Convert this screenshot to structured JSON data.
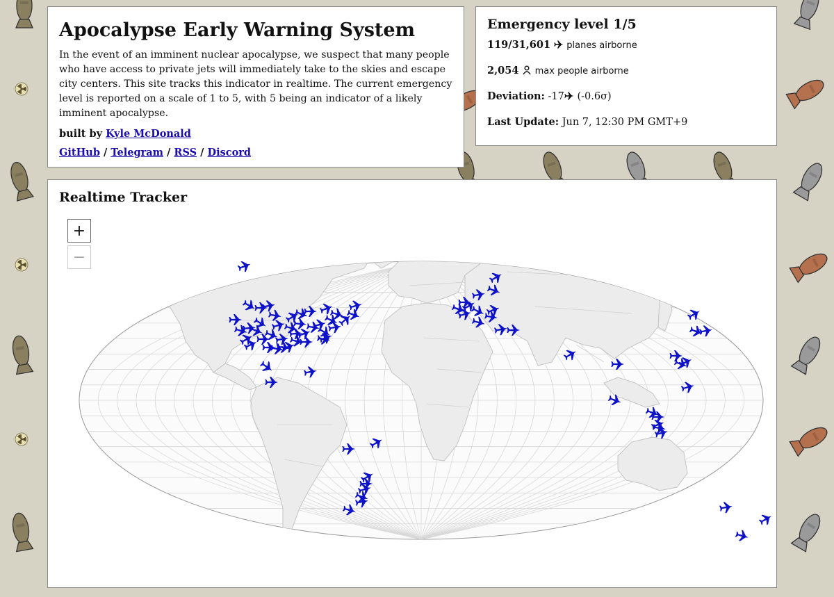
{
  "intro": {
    "title": "Apocalypse Early Warning System",
    "description": "In the event of an imminent nuclear apocalypse, we suspect that many people who have access to private jets will immediately take to the skies and escape city centers. This site tracks this indicator in realtime. The current emergency level is reported on a scale of 1 to 5, with 5 being an indicator of a likely imminent apocalypse.",
    "byline_prefix": "built by",
    "author": "Kyle McDonald",
    "links": [
      "GitHub",
      "Telegram",
      "RSS",
      "Discord"
    ],
    "link_sep": " / "
  },
  "status": {
    "title": "Emergency level 1/5",
    "planes_count": "119/31,601",
    "planes_label": "planes airborne",
    "people_count": "2,054",
    "people_label": "max people airborne",
    "deviation_label": "Deviation:",
    "deviation_value": "-17",
    "deviation_sigma": "(-0.6σ)",
    "update_label": "Last Update:",
    "update_value": "Jun 7, 12:30 PM GMT+9"
  },
  "tracker": {
    "title": "Realtime Tracker",
    "zoom_in": "+",
    "zoom_out": "−",
    "plane_color": "#0d12c8"
  },
  "icons": {
    "plane": "plane-icon",
    "person": "person-icon",
    "background": [
      "bomb-icon",
      "radiation-icon"
    ]
  }
}
